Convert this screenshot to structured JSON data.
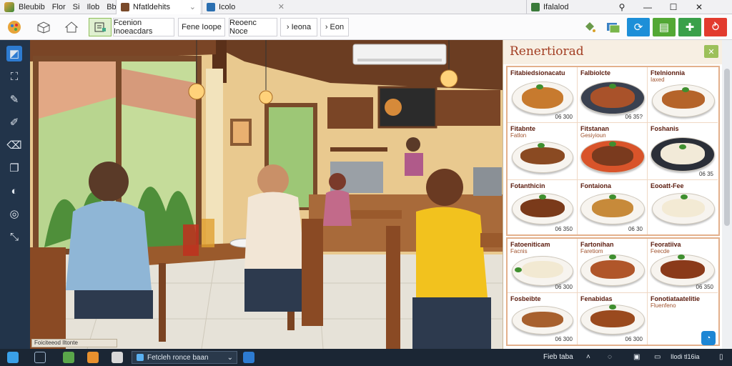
{
  "titlebar": {
    "menu": [
      "Bleubib",
      "Flor",
      "Si",
      "Ilob",
      "Bble"
    ],
    "tabs": [
      {
        "label": "Nfatldehits",
        "icon": "photo-icon"
      },
      {
        "label": "Icolo",
        "icon": "window-icon"
      },
      {
        "label": "Ifalalod",
        "icon": "app-icon"
      }
    ]
  },
  "toolbar": {
    "buttons": [
      "Fcenion Inoeacdars",
      "Fene Ioope",
      "Reoenc Noce",
      "Ieona",
      "Eon"
    ],
    "accent_colors": [
      "#1d8fd8",
      "#53a835",
      "#3aa04a",
      "#e23b2e"
    ]
  },
  "scene": {
    "caption": "Foiciteeod Iltonte",
    "description_icon": "restaurant-scene-image"
  },
  "menu_panel": {
    "title": "Renertiorad",
    "close_label": "✕",
    "top_grid": [
      {
        "name": "Fitabiedsionacatu",
        "sub": "",
        "price": "06 300"
      },
      {
        "name": "Falbiolcte",
        "sub": "",
        "price": "06 35?"
      },
      {
        "name": "Ftelnionnia",
        "sub": "Iaxed",
        "price": ""
      },
      {
        "name": "Fitabnte",
        "sub": "Fatlon",
        "price": ""
      },
      {
        "name": "Fitstanan",
        "sub": "Gesiyioun",
        "price": ""
      },
      {
        "name": "Foshanis",
        "sub": "",
        "price": "06 35"
      },
      {
        "name": "Fotanthicin",
        "sub": "",
        "price": "06 350"
      },
      {
        "name": "Fontaiona",
        "sub": "",
        "price": "06 30"
      },
      {
        "name": "Eooatt-Fee",
        "sub": "",
        "price": ""
      }
    ],
    "bottom_grid": [
      {
        "name": "Fatoeniticam",
        "sub": "Facnis",
        "price": "06 300"
      },
      {
        "name": "Fartonihan",
        "sub": "Faretiom",
        "price": ""
      },
      {
        "name": "Feoratiiva",
        "sub": "Feecde",
        "price": "06 350"
      },
      {
        "name": "Fosbeibte",
        "sub": "",
        "price": "06 300"
      },
      {
        "name": "Fenabidas",
        "sub": "",
        "price": "06 300"
      },
      {
        "name": "Fonotiataatelitie",
        "sub": "Fluenfeno",
        "price": ""
      }
    ]
  },
  "taskbar": {
    "search_text": "Fetcleh ronce baan",
    "tray_text": "Fieb taba",
    "clock": "Ilodi tl16ia"
  }
}
